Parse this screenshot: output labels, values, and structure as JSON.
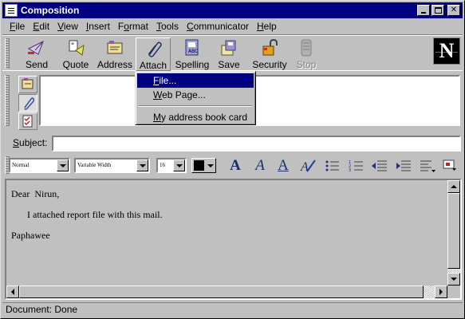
{
  "window": {
    "title": "Composition",
    "controls": [
      "minimize",
      "maximize",
      "close"
    ]
  },
  "menubar": {
    "items": [
      {
        "label": "File",
        "accel": "F",
        "rest": "ile"
      },
      {
        "label": "Edit",
        "accel": "E",
        "rest": "dit"
      },
      {
        "label": "View",
        "accel": "V",
        "rest": "iew"
      },
      {
        "label": "Insert",
        "accel": "I",
        "rest": "nsert"
      },
      {
        "label": "Format",
        "accel": "",
        "rest": "Format",
        "pre": "F",
        "accel2": "o",
        "post": "rmat"
      },
      {
        "label": "Tools",
        "accel": "T",
        "rest": "ools"
      },
      {
        "label": "Communicator",
        "accel": "C",
        "rest": "ommunicator"
      },
      {
        "label": "Help",
        "accel": "H",
        "rest": "elp"
      }
    ]
  },
  "toolbar": {
    "buttons": [
      {
        "label": "Send",
        "icon": "send-icon"
      },
      {
        "label": "Quote",
        "icon": "quote-icon"
      },
      {
        "label": "Address",
        "icon": "address-icon"
      },
      {
        "label": "Attach",
        "icon": "attach-icon",
        "state": "pressed"
      },
      {
        "label": "Spelling",
        "icon": "spelling-icon"
      },
      {
        "label": "Save",
        "icon": "save-icon"
      },
      {
        "label": "Security",
        "icon": "security-icon"
      },
      {
        "label": "Stop",
        "icon": "stop-icon",
        "state": "disabled"
      }
    ],
    "logo": "N"
  },
  "attach_menu": {
    "items": [
      {
        "label": "File...",
        "accel": "F",
        "rest": "ile...",
        "highlighted": true
      },
      {
        "label": "Web Page...",
        "accel": "W",
        "rest": "eb Page..."
      },
      {
        "label": "My address book card",
        "accel": "M",
        "rest": "y address book card"
      }
    ]
  },
  "subject": {
    "label": "Subject:",
    "accel": "S",
    "rest": "ubject:",
    "value": ""
  },
  "formatbar": {
    "paragraph_style": "Normal",
    "font": "Variable Width",
    "size": "16",
    "text_color": "#000000"
  },
  "message": {
    "lines": [
      "Dear  Nirun,",
      "I attached report file with this mail.",
      "Paphawee"
    ]
  },
  "status": {
    "text": "Document: Done"
  },
  "colors": {
    "title_bar": "#000080",
    "face": "#c0c0c0",
    "highlight": "#000080"
  }
}
